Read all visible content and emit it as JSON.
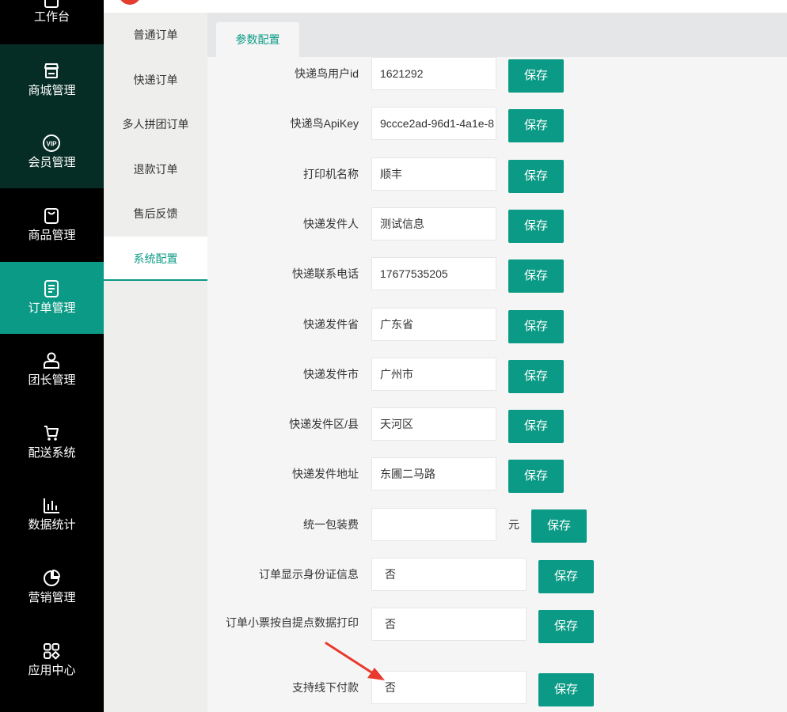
{
  "sidebar": {
    "items": [
      {
        "label": "工作台",
        "icon": "workbench-icon"
      },
      {
        "label": "商城管理",
        "icon": "store-icon"
      },
      {
        "label": "会员管理",
        "icon": "vip-icon"
      },
      {
        "label": "商品管理",
        "icon": "goods-icon"
      },
      {
        "label": "订单管理",
        "icon": "order-icon"
      },
      {
        "label": "团长管理",
        "icon": "leader-icon"
      },
      {
        "label": "配送系统",
        "icon": "delivery-icon"
      },
      {
        "label": "数据统计",
        "icon": "chart-icon"
      },
      {
        "label": "营销管理",
        "icon": "pie-icon"
      },
      {
        "label": "应用中心",
        "icon": "apps-icon"
      }
    ],
    "active": "订单管理"
  },
  "submenu": {
    "items": [
      "普通订单",
      "快递订单",
      "多人拼团订单",
      "退款订单",
      "售后反馈",
      "系统配置"
    ],
    "active": "系统配置"
  },
  "tabs": {
    "active_label": "参数配置"
  },
  "form": {
    "save_label": "保存",
    "rows": [
      {
        "label": "快递鸟用户id",
        "value": "1621292"
      },
      {
        "label": "快递鸟ApiKey",
        "value": "9ccce2ad-96d1-4a1e-8"
      },
      {
        "label": "打印机名称",
        "value": "顺丰"
      },
      {
        "label": "快递发件人",
        "value": "测试信息"
      },
      {
        "label": "快递联系电话",
        "value": "17677535205"
      },
      {
        "label": "快递发件省",
        "value": "广东省"
      },
      {
        "label": "快递发件市",
        "value": "广州市"
      },
      {
        "label": "快递发件区/县",
        "value": "天河区"
      },
      {
        "label": "快递发件地址",
        "value": "东圃二马路"
      },
      {
        "label": "统一包装费",
        "value": "",
        "unit": "元"
      },
      {
        "label": "订单显示身份证信息",
        "value": "否"
      },
      {
        "label": "订单小票按自提点数据打印",
        "value": "否"
      },
      {
        "label": "支持线下付款",
        "value": "否"
      }
    ]
  },
  "colors": {
    "accent": "#0b9a85",
    "sidebar_bg": "#000000",
    "sidebar_dark": "#062d25",
    "arrow": "#e8392c",
    "logo": "#e43c2f"
  }
}
